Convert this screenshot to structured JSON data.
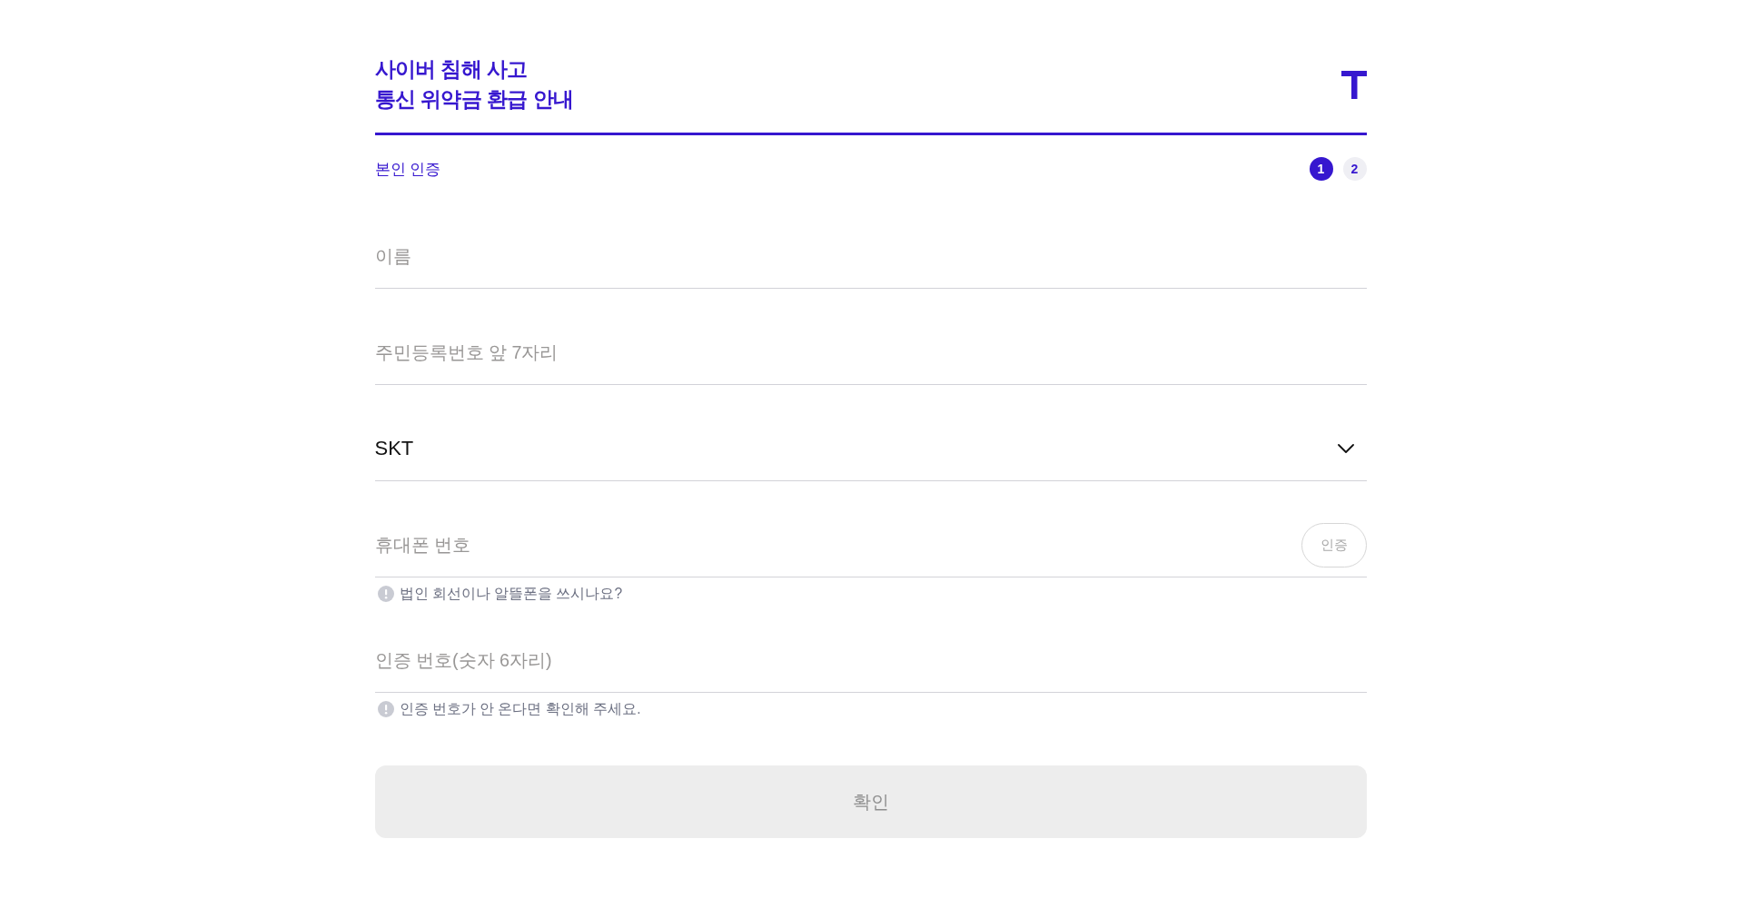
{
  "header": {
    "title_lines": [
      "사이버 침해 사고",
      "통신 위약금 환급 안내"
    ]
  },
  "section": {
    "title": "본인 인증",
    "steps": [
      {
        "label": "1",
        "selected": true
      },
      {
        "label": "2",
        "selected": false
      }
    ]
  },
  "fields": [
    {
      "kind": "text",
      "placeholder": "이름"
    },
    {
      "kind": "text",
      "placeholder": "주민등록번호 앞 7자리"
    },
    {
      "kind": "select",
      "value": "SKT"
    },
    {
      "kind": "text",
      "placeholder": "휴대폰 번호",
      "button": {
        "label": "인증",
        "disabled": true
      },
      "hint": "법인 회선이나 알뜰폰을 쓰시나요?"
    },
    {
      "kind": "text",
      "placeholder": "인증 번호(숫자 6자리)",
      "hint": "인증 번호가 안 온다면 확인해 주세요."
    }
  ],
  "submit": {
    "label": "확인",
    "disabled": true
  }
}
